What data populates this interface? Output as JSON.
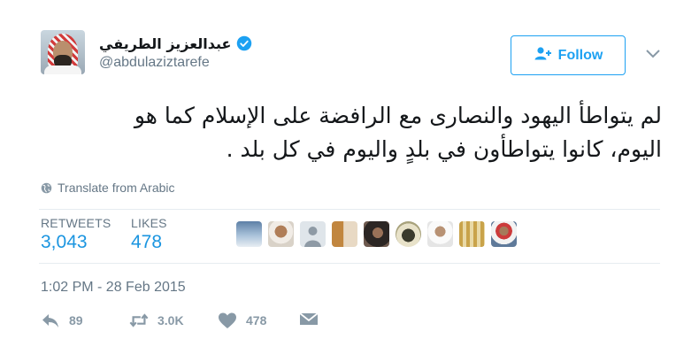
{
  "user": {
    "display_name": "عبدالعزيز الطريفي",
    "handle": "@abdulaziztarefe",
    "verified": true
  },
  "follow_button": {
    "label": "Follow"
  },
  "tweet": {
    "text_line1": "لم يتواطأ اليهود والنصارى مع الرافضة على الإسلام كما هو",
    "text_line2": "اليوم، كانوا يتواطأون في بلدٍ واليوم في كل بلد ."
  },
  "translate": {
    "label": "Translate from Arabic"
  },
  "stats": {
    "retweets_label": "RETWEETS",
    "retweets_value": "3,043",
    "likes_label": "LIKES",
    "likes_value": "478"
  },
  "timestamp": "1:02 PM - 28 Feb 2015",
  "actions": {
    "reply_count": "89",
    "retweet_count": "3.0K",
    "like_count": "478"
  },
  "colors": {
    "accent": "#1da1f2",
    "stat_value": "#1b95e0",
    "muted": "#657786",
    "action_icon": "#8899a6"
  },
  "icons": [
    "verified-icon",
    "follow-person-plus-icon",
    "chevron-down-icon",
    "globe-icon",
    "reply-icon",
    "retweet-icon",
    "heart-icon",
    "message-icon"
  ]
}
